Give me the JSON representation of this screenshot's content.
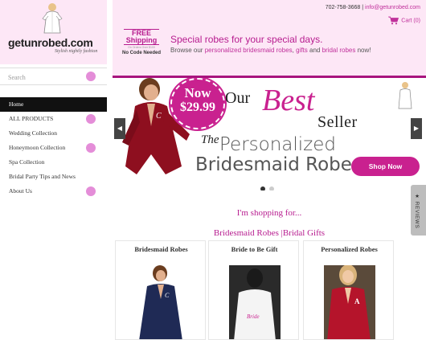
{
  "brand": {
    "logo_text": "getunrobed.com",
    "tagline": "Stylish nightly fashion"
  },
  "search": {
    "placeholder": "Search"
  },
  "nav": {
    "items": [
      {
        "label": "Home",
        "active": true,
        "expandable": false
      },
      {
        "label": "ALL PRODUCTS",
        "active": false,
        "expandable": true
      },
      {
        "label": "Wedding Collection",
        "active": false,
        "expandable": false
      },
      {
        "label": "Honeymoon Collection",
        "active": false,
        "expandable": true
      },
      {
        "label": "Spa Collection",
        "active": false,
        "expandable": false
      },
      {
        "label": "Bridal Party Tips and News",
        "active": false,
        "expandable": false
      },
      {
        "label": "About Us",
        "active": false,
        "expandable": true
      }
    ]
  },
  "header": {
    "phone": "702-758-3668",
    "separator": " | ",
    "email": "info@getunrobed.com",
    "cart_label": "Cart (0)"
  },
  "free_shipping": {
    "title_1": "FREE",
    "title_2": "Shipping",
    "fine_print": "On Orders Over $100",
    "code_text": "No Code Needed"
  },
  "promo": {
    "headline": "Special robes for your special days.",
    "text_prefix": "Browse our ",
    "link1": "personalized bridesmaid robes",
    "sep1": ", ",
    "link2": "gifts",
    "sep2": " and ",
    "link3": "bridal robes",
    "text_suffix": " now!"
  },
  "hero": {
    "badge_line1": "Now",
    "badge_line2": "$29.99",
    "our": "Our",
    "best": "Best",
    "seller": "Seller",
    "the": "The",
    "personalized": "Personalized",
    "bridesmaid_robe": "Bridesmaid Robe",
    "cta": "Shop Now",
    "prev": "◀",
    "next": "▶",
    "slides": 2,
    "current_slide": 1
  },
  "shopping": {
    "title": "I'm shopping for...",
    "subtitle": "Bridesmaid Robes |Bridal Gifts"
  },
  "cards": [
    {
      "title": "Bridesmaid Robes",
      "robe_color": "#1f2a55"
    },
    {
      "title": "Bride to Be Gift",
      "robe_color": "#f4f4f4"
    },
    {
      "title": "Personalized Robes",
      "robe_color": "#b5142b"
    }
  ],
  "reviews_tab": {
    "label": "★ REVIEWS"
  },
  "colors": {
    "accent": "#c9218f",
    "brand_dark": "#a8157e",
    "band_bg": "#fde7f6",
    "pink_dot": "#e48dd8"
  }
}
